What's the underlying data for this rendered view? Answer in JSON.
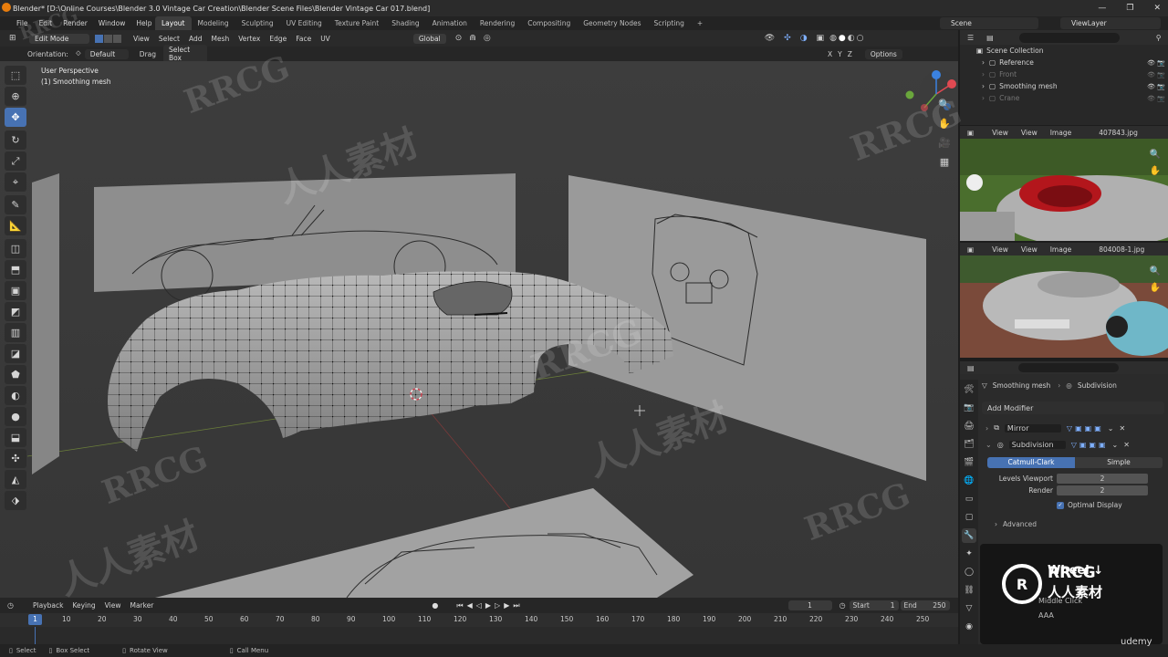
{
  "window": {
    "title": "Blender* [D:\\Online Courses\\Blender 3.0 Vintage Car Creation\\Blender Scene Files\\Blender Vintage Car 017.blend]",
    "controls": [
      "—",
      "❐",
      "✕"
    ]
  },
  "menu": {
    "items": [
      "File",
      "Edit",
      "Render",
      "Window",
      "Help"
    ]
  },
  "workspaces": {
    "tabs": [
      "Layout",
      "Modeling",
      "Sculpting",
      "UV Editing",
      "Texture Paint",
      "Shading",
      "Animation",
      "Rendering",
      "Compositing",
      "Geometry Nodes",
      "Scripting"
    ],
    "active": "Layout",
    "add": "+"
  },
  "scene": {
    "name": "Scene",
    "view_layer": "ViewLayer"
  },
  "viewport_header": {
    "mode": "Edit Mode",
    "menus": [
      "View",
      "Select",
      "Add",
      "Mesh",
      "Vertex",
      "Edge",
      "Face",
      "UV"
    ],
    "transform": "Global"
  },
  "tool_header": {
    "orientation_label": "Orientation:",
    "orientation_value": "Default",
    "drag_label": "Drag",
    "drag_value": "Select Box",
    "options": "Options",
    "axes": [
      "X",
      "Y",
      "Z"
    ]
  },
  "viewport": {
    "perspective": "User Perspective",
    "object": "(1) Smoothing mesh"
  },
  "toolbar": {
    "tools": [
      {
        "name": "select-box-icon",
        "glyph": "⬚",
        "active": false
      },
      {
        "name": "cursor-icon",
        "glyph": "⊕",
        "active": false
      },
      {
        "name": "move-icon",
        "glyph": "✥",
        "active": true
      },
      {
        "name": "rotate-icon",
        "glyph": "↻",
        "active": false
      },
      {
        "name": "scale-icon",
        "glyph": "⤢",
        "active": false
      },
      {
        "name": "transform-icon",
        "glyph": "⌖",
        "active": false
      },
      {
        "name": "annotate-icon",
        "glyph": "✎",
        "active": false
      },
      {
        "name": "measure-icon",
        "glyph": "📐",
        "active": false
      },
      {
        "name": "add-cube-icon",
        "glyph": "◫",
        "active": false
      },
      {
        "name": "extrude-icon",
        "glyph": "⬒",
        "active": false
      },
      {
        "name": "inset-icon",
        "glyph": "▣",
        "active": false
      },
      {
        "name": "bevel-icon",
        "glyph": "◩",
        "active": false
      },
      {
        "name": "loop-cut-icon",
        "glyph": "▥",
        "active": false
      },
      {
        "name": "knife-icon",
        "glyph": "◪",
        "active": false
      },
      {
        "name": "poly-build-icon",
        "glyph": "⬟",
        "active": false
      },
      {
        "name": "spin-icon",
        "glyph": "◐",
        "active": false
      },
      {
        "name": "smooth-icon",
        "glyph": "●",
        "active": false
      },
      {
        "name": "edge-slide-icon",
        "glyph": "⬓",
        "active": false
      },
      {
        "name": "shrink-icon",
        "glyph": "✣",
        "active": false
      },
      {
        "name": "shear-icon",
        "glyph": "◭",
        "active": false
      },
      {
        "name": "rip-icon",
        "glyph": "⬗",
        "active": false
      }
    ]
  },
  "nav_gizmo": {
    "axes": [
      "X",
      "Y",
      "Z"
    ],
    "buttons": [
      {
        "name": "zoom-icon",
        "glyph": "🔍"
      },
      {
        "name": "pan-hand-icon",
        "glyph": "✋"
      },
      {
        "name": "camera-icon",
        "glyph": "🎥"
      },
      {
        "name": "grid-icon",
        "glyph": "▦"
      }
    ]
  },
  "outliner": {
    "rows": [
      {
        "label": "Scene Collection",
        "indent": 0
      },
      {
        "label": "Reference",
        "indent": 1
      },
      {
        "label": "Front",
        "indent": 1
      },
      {
        "label": "Smoothing mesh",
        "indent": 1
      },
      {
        "label": "Crane",
        "indent": 1
      }
    ]
  },
  "image_editors": [
    {
      "menus": [
        "View",
        "View",
        "Image"
      ],
      "file": "407843.jpg"
    },
    {
      "menus": [
        "View",
        "View",
        "Image"
      ],
      "file": "804008-1.jpg"
    }
  ],
  "properties": {
    "breadcrumb_object": "Smoothing mesh",
    "breadcrumb_modifier": "Subdivision",
    "add_modifier": "Add Modifier",
    "modifiers": [
      "Mirror",
      "Subdivision"
    ],
    "subdivision": {
      "type_options": [
        "Catmull-Clark",
        "Simple"
      ],
      "type_active": "Catmull-Clark",
      "levels_viewport_label": "Levels Viewport",
      "levels_viewport": "2",
      "render_label": "Render",
      "render": "2",
      "optimal_display_label": "Optimal Display",
      "optimal_display": true,
      "advanced_label": "Advanced"
    }
  },
  "timeline": {
    "menus": [
      "Playback",
      "Keying",
      "View",
      "Marker"
    ],
    "current_frame": "1",
    "start_label": "Start",
    "start": "1",
    "end_label": "End",
    "end": "250",
    "ticks": [
      "10",
      "20",
      "30",
      "40",
      "50",
      "60",
      "70",
      "80",
      "90",
      "100",
      "110",
      "120",
      "130",
      "140",
      "150",
      "160",
      "170",
      "180",
      "190",
      "200",
      "210",
      "220",
      "230",
      "240",
      "250"
    ],
    "frame_marker": "1"
  },
  "status_bar": {
    "items": [
      "Select",
      "Box Select",
      "Rotate View",
      "Call Menu"
    ]
  },
  "overlay_card": {
    "title": "Wheel ↓",
    "line1": "Middle Click",
    "line2": "AAA"
  },
  "watermarks": {
    "brand": "RRCG",
    "cn": "人人素材",
    "udemy": "udemy"
  }
}
